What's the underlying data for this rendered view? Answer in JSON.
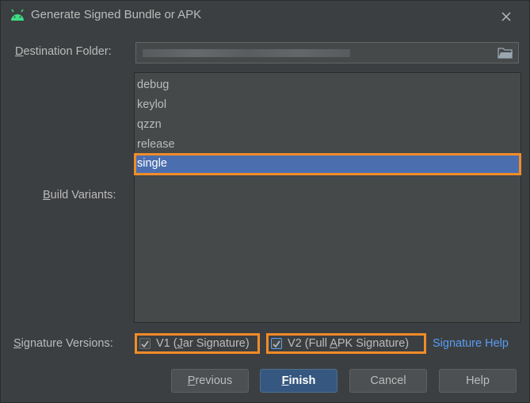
{
  "window": {
    "title": "Generate Signed Bundle or APK",
    "icon": "android-icon",
    "close_icon": "close-icon"
  },
  "destination": {
    "label_prefix": "",
    "label_mnemonic": "D",
    "label_rest": "estination Folder:",
    "value": "",
    "browse_icon": "folder-icon"
  },
  "build_variants": {
    "label_mnemonic": "B",
    "label_rest": "uild Variants:",
    "items": [
      {
        "label": "debug",
        "selected": false
      },
      {
        "label": "keylol",
        "selected": false
      },
      {
        "label": "qzzn",
        "selected": false
      },
      {
        "label": "release",
        "selected": false
      },
      {
        "label": "single",
        "selected": true
      }
    ]
  },
  "signature": {
    "label_mnemonic": "S",
    "label_rest": "ignature Versions:",
    "v1": {
      "pre": "V1 (",
      "mn": "J",
      "post": "ar Signature)",
      "checked": true
    },
    "v2": {
      "pre": "V2 (Full ",
      "mn": "A",
      "post": "PK Signature)",
      "checked": true
    },
    "help_link": "Signature Help"
  },
  "buttons": {
    "previous": {
      "mn": "P",
      "rest": "revious"
    },
    "finish": {
      "mn": "F",
      "rest": "inish"
    },
    "cancel": "Cancel",
    "help": "Help"
  },
  "colors": {
    "background": "#3c3f41",
    "selection": "#4b6eaf",
    "highlight_outline": "#f28c28",
    "link": "#589df6",
    "primary_button": "#365880"
  }
}
